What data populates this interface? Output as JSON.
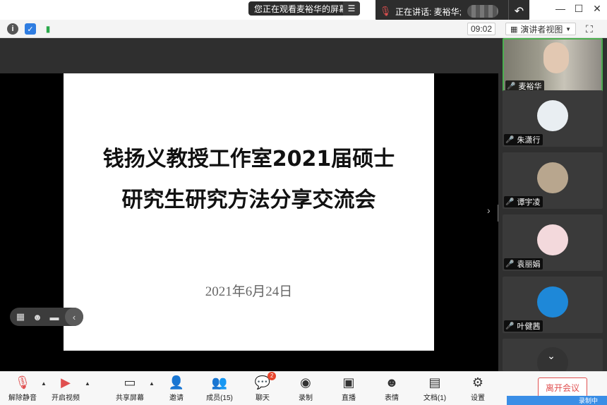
{
  "titlebar": {
    "viewing_text": "您正在观看麦裕华的屏幕",
    "viewing_menu_icon": "menu-icon",
    "speaking_text": "正在讲话: 麦裕华;",
    "minimize": "—",
    "maximize": "☐",
    "close": "✕"
  },
  "infobar": {
    "timer": "09:02",
    "view_mode": "演讲者视图"
  },
  "slide": {
    "line1": "钱扬义教授工作室2021届硕士",
    "line2": "研究生研究方法分享交流会",
    "date": "2021年6月24日"
  },
  "participants": [
    {
      "name": "麦裕华",
      "mic": "on",
      "active": true,
      "avatar_color": "#8a8f92"
    },
    {
      "name": "朱潇行",
      "mic": "muted",
      "active": false,
      "avatar_color": "#e9eef2"
    },
    {
      "name": "谭宇凌",
      "mic": "muted",
      "active": false,
      "avatar_color": "#b8a68e"
    },
    {
      "name": "袁丽娟",
      "mic": "muted",
      "active": false,
      "avatar_color": "#f3d9dc"
    },
    {
      "name": "叶健茜",
      "mic": "muted",
      "active": false,
      "avatar_color": "#1e88d8"
    }
  ],
  "toolbar": {
    "unmute": "解除静音",
    "start_video": "开启视频",
    "share_screen": "共享屏幕",
    "invite": "邀请",
    "members": "成员(15)",
    "chat": "聊天",
    "chat_badge": "2",
    "record": "录制",
    "live": "直播",
    "reactions": "表情",
    "documents": "文档(1)",
    "settings": "设置",
    "leave": "离开会议",
    "recording_tag": "录制中"
  },
  "colors": {
    "accent_green": "#4caf50",
    "leave_red": "#e05050",
    "badge_red": "#e8452c"
  }
}
